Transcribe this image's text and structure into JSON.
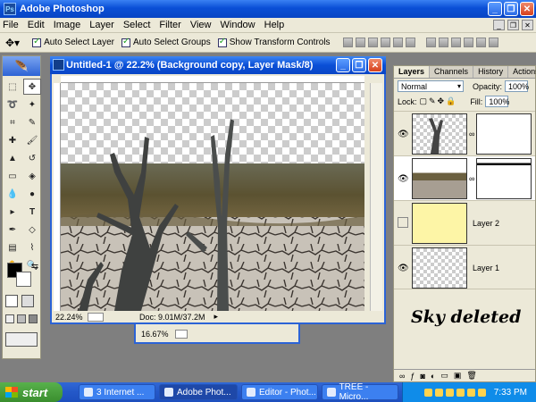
{
  "app": {
    "title": "Adobe Photoshop"
  },
  "menu": [
    "File",
    "Edit",
    "Image",
    "Layer",
    "Select",
    "Filter",
    "View",
    "Window",
    "Help"
  ],
  "options": {
    "auto_select_layer": "Auto Select Layer",
    "auto_select_groups": "Auto Select Groups",
    "show_transform_controls": "Show Transform Controls"
  },
  "document": {
    "title": "Untitled-1 @ 22.2% (Background copy, Layer Mask/8)",
    "zoom": "22.24%",
    "doc_size": "Doc: 9.01M/37.2M"
  },
  "document2": {
    "zoom": "16.67%"
  },
  "layers_panel": {
    "tabs": [
      "Layers",
      "Channels",
      "History",
      "Actions"
    ],
    "blend_mode": "Normal",
    "opacity_label": "Opacity:",
    "opacity": "100%",
    "lock_label": "Lock:",
    "fill_label": "Fill:",
    "fill": "100%",
    "layers": [
      {
        "name": "",
        "visible": true
      },
      {
        "name": "",
        "visible": true,
        "selected": true
      },
      {
        "name": "Layer 2",
        "visible": false
      },
      {
        "name": "Layer 1",
        "visible": true
      }
    ]
  },
  "annotation": "Sky deleted",
  "taskbar": {
    "start": "start",
    "tasks": [
      "3 Internet ...",
      "Adobe Phot...",
      "Editor - Phot...",
      "TREE - Micro..."
    ],
    "clock": "7:33 PM"
  },
  "colors": {
    "xp_blue": "#0a4fd6",
    "layer2_fill": "#fdf5a6"
  }
}
